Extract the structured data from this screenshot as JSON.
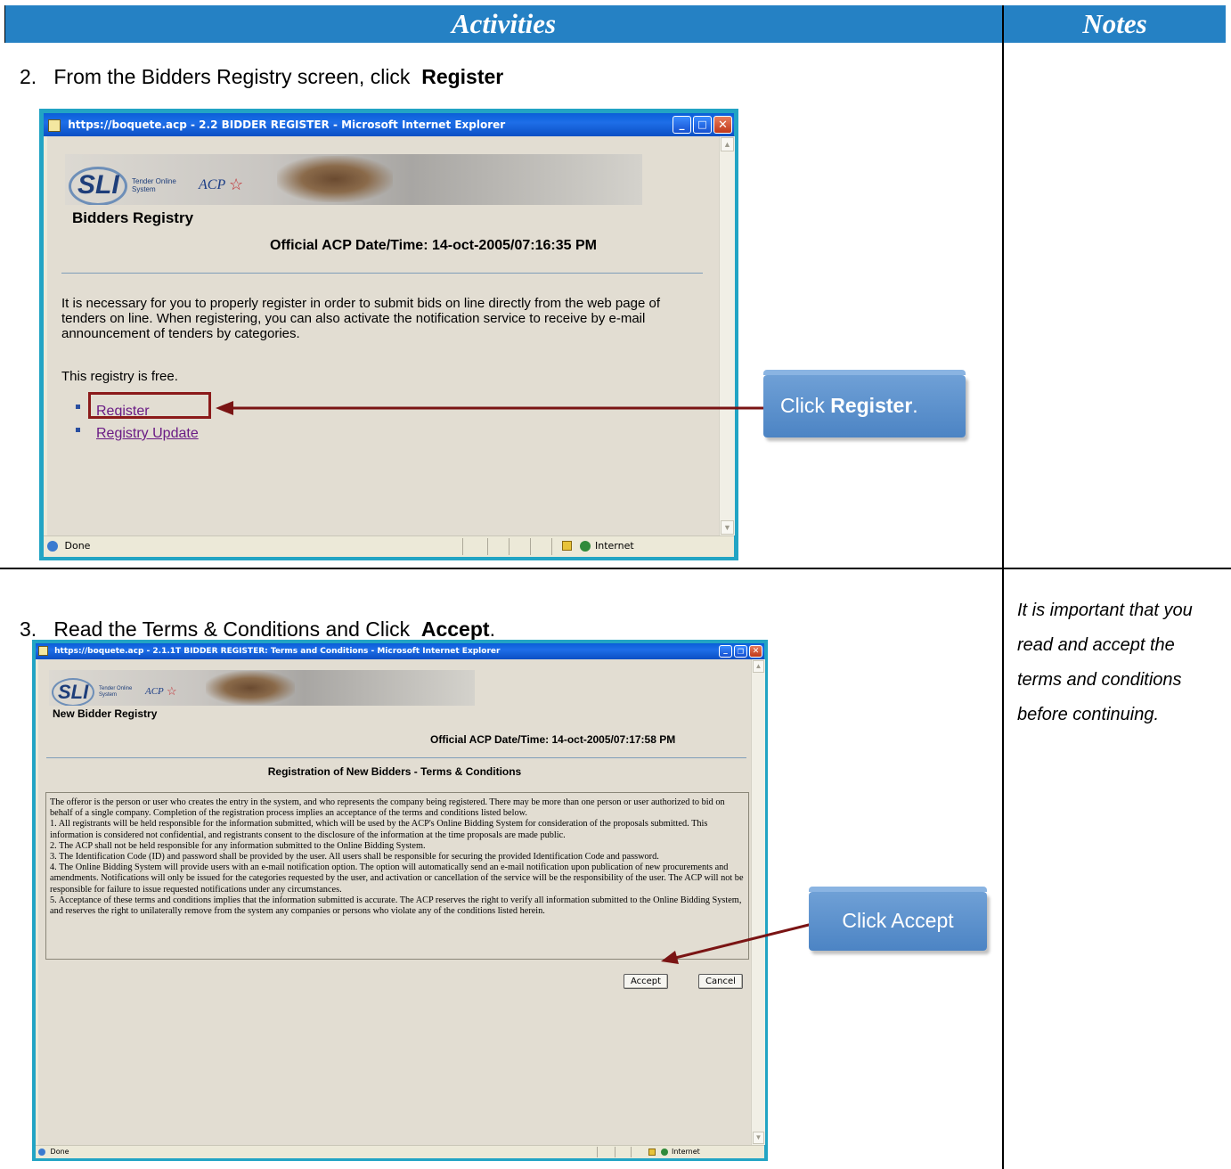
{
  "header": {
    "activities": "Activities",
    "notes": "Notes"
  },
  "step2": {
    "number": "2.",
    "text_prefix": "From the Bidders Registry screen, click",
    "bold": "Register",
    "window": {
      "title": "https://boquete.acp - 2.2 BIDDER REGISTER - Microsoft Internet Explorer",
      "logo_text": "SLI",
      "logo_sub1": "Tender Online",
      "logo_sub2": "System",
      "acp_logo": "ACP",
      "page_heading": "Bidders Registry",
      "date_label": "Official ACP Date/Time: 14-oct-2005/07:16:35 PM",
      "paragraph1": "It is necessary for you to properly register in order to submit bids on line directly from the web page of tenders on line. When registering, you can also activate the notification service to receive by e-mail announcement of tenders by categories.",
      "paragraph2": "This registry is free.",
      "links": [
        "Register",
        "Registry Update"
      ],
      "status_text": "Done",
      "zone_text": "Internet"
    },
    "callout_prefix": "Click ",
    "callout_bold": "Register",
    "callout_suffix": "."
  },
  "step3": {
    "number": "3.",
    "text_prefix": "Read the Terms & Conditions and Click",
    "bold": "Accept",
    "text_suffix": ".",
    "note": "It is important that you read and accept the terms and conditions before continuing.",
    "window": {
      "title": "https://boquete.acp - 2.1.1T BIDDER REGISTER: Terms and Conditions - Microsoft Internet Explorer",
      "logo_text": "SLI",
      "logo_sub1": "Tender Online",
      "logo_sub2": "System",
      "acp_logo": "ACP",
      "page_heading": "New Bidder Registry",
      "date_label": "Official ACP Date/Time: 14-oct-2005/07:17:58 PM",
      "section_title": "Registration of New Bidders - Terms & Conditions",
      "terms": [
        "The offeror is the person or user who creates the entry in the system, and who represents the company being registered. There may be more than one person or user authorized to bid on behalf of a single company. Completion of the registration process implies an acceptance of the terms and conditions listed below.",
        "1. All registrants will be held responsible for the information submitted, which will be used by the ACP's Online Bidding System for consideration of the proposals submitted. This information is considered not confidential, and registrants consent to the disclosure of the information at the time proposals are made public.",
        "2. The ACP shall not be held responsible for any information submitted to the Online Bidding System.",
        "3. The Identification Code (ID) and password shall be provided by the user. All users shall be responsible for securing the provided Identification Code and password.",
        "4. The Online Bidding System will provide users with an e-mail notification option. The option will automatically send an e-mail notification upon publication of new procurements and amendments. Notifications will only be issued for the categories requested by the user, and activation or cancellation of the service will be the responsibility of the user. The ACP will not be responsible for failure to issue requested notifications under any circumstances.",
        "5. Acceptance of these terms and conditions implies that the information submitted is accurate. The ACP reserves the right to verify all information submitted to the Online Bidding System, and reserves the right to unilaterally remove from the system any companies or persons who violate any of the conditions listed herein."
      ],
      "accept_label": "Accept",
      "cancel_label": "Cancel",
      "status_text": "Done",
      "zone_text": "Internet"
    },
    "callout": "Click Accept"
  },
  "colors": {
    "header_bg": "#2581c4",
    "callout_bg": "#5b90cc",
    "highlight_box": "#8b1a1a",
    "arrow": "#7a1414"
  },
  "icons": [
    "ie-page-icon",
    "minimize-icon",
    "maximize-icon",
    "close-icon",
    "lock-icon",
    "globe-icon",
    "arrow-pointer-icon"
  ]
}
